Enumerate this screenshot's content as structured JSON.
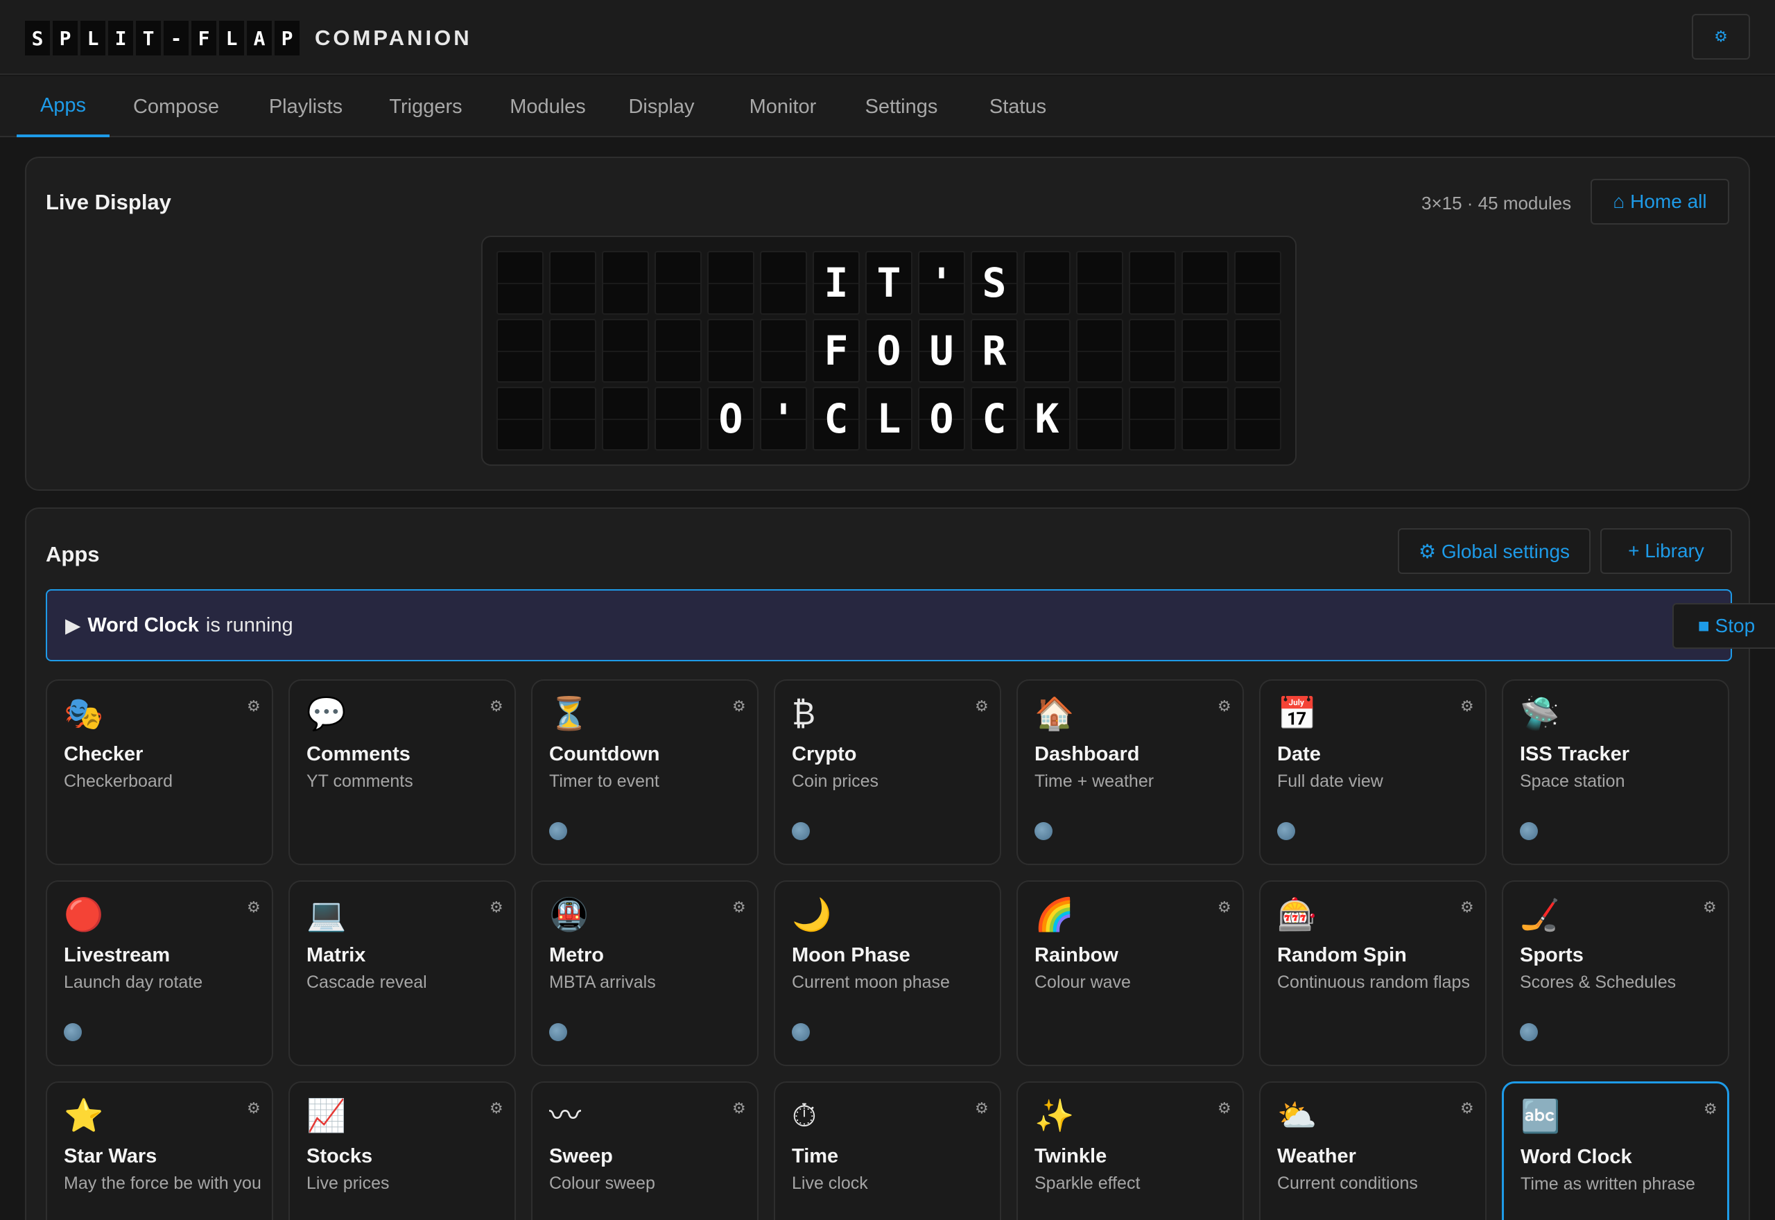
{
  "header": {
    "logo_letters": [
      "S",
      "P",
      "L",
      "I",
      "T",
      "-",
      "F",
      "L",
      "A",
      "P"
    ],
    "logo_word": "COMPANION",
    "settings_icon": "⚙"
  },
  "tabs": [
    {
      "label": "Apps",
      "active": true
    },
    {
      "label": "Compose"
    },
    {
      "label": "Playlists"
    },
    {
      "label": "Triggers"
    },
    {
      "label": "Modules"
    },
    {
      "label": "Display"
    },
    {
      "label": "Monitor"
    },
    {
      "label": "Settings"
    },
    {
      "label": "Status"
    }
  ],
  "live_display": {
    "title": "Live Display",
    "meta": "3×15 · 45 modules",
    "home_all_label": "⌂ Home all",
    "rows": [
      "      IT'S     ",
      "      FOUR     ",
      "    O'CLOCK    "
    ]
  },
  "apps": {
    "title": "Apps",
    "global_settings_label": "⚙ Global settings",
    "library_label": "+ Library",
    "running": {
      "prefix": "▶",
      "app": "Word Clock",
      "suffix": "is running",
      "stop_label": "■ Stop"
    },
    "cards": [
      {
        "icon": "🎭",
        "name": "Checker",
        "desc": "Checkerboard",
        "globe": false
      },
      {
        "icon": "💬",
        "name": "Comments",
        "desc": "YT comments",
        "globe": false
      },
      {
        "icon": "⏳",
        "name": "Countdown",
        "desc": "Timer to event",
        "globe": true
      },
      {
        "icon": "₿",
        "name": "Crypto",
        "desc": "Coin prices",
        "globe": true
      },
      {
        "icon": "🏠",
        "name": "Dashboard",
        "desc": "Time + weather",
        "globe": true
      },
      {
        "icon": "📅",
        "name": "Date",
        "desc": "Full date view",
        "globe": true
      },
      {
        "icon": "🛸",
        "name": "ISS Tracker",
        "desc": "Space station",
        "globe": true,
        "no_gear": true
      },
      {
        "icon": "🔴",
        "name": "Livestream",
        "desc": "Launch day rotate",
        "globe": true
      },
      {
        "icon": "💻",
        "name": "Matrix",
        "desc": "Cascade reveal",
        "globe": false
      },
      {
        "icon": "🚇",
        "name": "Metro",
        "desc": "MBTA arrivals",
        "globe": true
      },
      {
        "icon": "🌙",
        "name": "Moon Phase",
        "desc": "Current moon phase",
        "globe": true,
        "no_gear": true
      },
      {
        "icon": "🌈",
        "name": "Rainbow",
        "desc": "Colour wave",
        "globe": false
      },
      {
        "icon": "🎰",
        "name": "Random Spin",
        "desc": "Continuous random flaps",
        "globe": false
      },
      {
        "icon": "🏒",
        "name": "Sports",
        "desc": "Scores & Schedules",
        "globe": true
      },
      {
        "icon": "⭐",
        "name": "Star Wars",
        "desc": "May the force be with you",
        "globe": false
      },
      {
        "icon": "📈",
        "name": "Stocks",
        "desc": "Live prices",
        "globe": false
      },
      {
        "icon": "〰",
        "name": "Sweep",
        "desc": "Colour sweep",
        "globe": false
      },
      {
        "icon": "⏱",
        "name": "Time",
        "desc": "Live clock",
        "globe": false
      },
      {
        "icon": "✨",
        "name": "Twinkle",
        "desc": "Sparkle effect",
        "globe": false
      },
      {
        "icon": "⛅",
        "name": "Weather",
        "desc": "Current conditions",
        "globe": false
      },
      {
        "icon": "🔤",
        "name": "Word Clock",
        "desc": "Time as written phrase",
        "globe": false,
        "selected": true
      }
    ]
  },
  "colors": {
    "accent": "#1e9be8",
    "background": "#171717",
    "panel": "#1e1e1e",
    "running_bg": "#272740"
  }
}
